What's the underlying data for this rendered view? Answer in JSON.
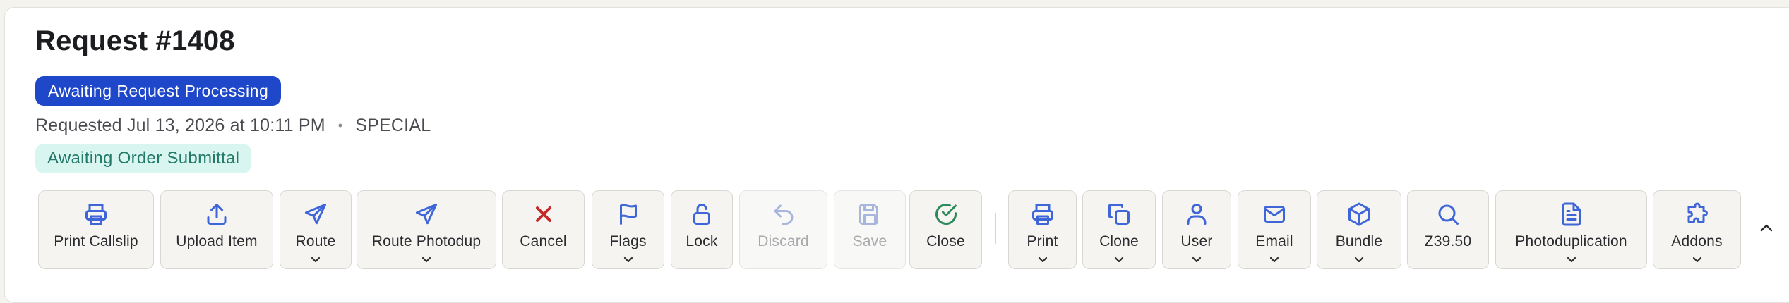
{
  "header": {
    "title": "Request #1408",
    "status_badge": "Awaiting Request Processing",
    "requested": "Requested Jul 13, 2026 at 10:11 PM",
    "separator": "•",
    "type": "SPECIAL",
    "order_badge": "Awaiting Order Submittal"
  },
  "colors": {
    "status_badge_bg": "#1f47c9",
    "order_badge_bg": "#d8f6ef",
    "icon_accent": "#3e66d8",
    "cancel_icon": "#c52a2a",
    "close_icon": "#2b8a5b"
  },
  "toolbar": {
    "primary": [
      {
        "label": "Print Callslip",
        "icon": "printer-icon",
        "dropdown": false,
        "disabled": false
      },
      {
        "label": "Upload Item",
        "icon": "upload-icon",
        "dropdown": false,
        "disabled": false
      },
      {
        "label": "Route",
        "icon": "send-icon",
        "dropdown": true,
        "disabled": false
      },
      {
        "label": "Route Photodup",
        "icon": "send-icon",
        "dropdown": true,
        "disabled": false
      },
      {
        "label": "Cancel",
        "icon": "x-icon",
        "dropdown": false,
        "disabled": false
      },
      {
        "label": "Flags",
        "icon": "flag-icon",
        "dropdown": true,
        "disabled": false
      },
      {
        "label": "Lock",
        "icon": "lock-icon",
        "dropdown": false,
        "disabled": false
      },
      {
        "label": "Discard",
        "icon": "undo-icon",
        "dropdown": false,
        "disabled": true
      },
      {
        "label": "Save",
        "icon": "save-icon",
        "dropdown": false,
        "disabled": true
      },
      {
        "label": "Close",
        "icon": "check-circle-icon",
        "dropdown": false,
        "disabled": false
      }
    ],
    "secondary": [
      {
        "label": "Print",
        "icon": "printer-icon",
        "dropdown": true,
        "disabled": false
      },
      {
        "label": "Clone",
        "icon": "copy-icon",
        "dropdown": true,
        "disabled": false
      },
      {
        "label": "User",
        "icon": "user-icon",
        "dropdown": true,
        "disabled": false
      },
      {
        "label": "Email",
        "icon": "mail-icon",
        "dropdown": true,
        "disabled": false
      },
      {
        "label": "Bundle",
        "icon": "box-icon",
        "dropdown": true,
        "disabled": false
      },
      {
        "label": "Z39.50",
        "icon": "search-icon",
        "dropdown": false,
        "disabled": false
      },
      {
        "label": "Photoduplication",
        "icon": "file-text-icon",
        "dropdown": true,
        "disabled": false
      },
      {
        "label": "Addons",
        "icon": "puzzle-icon",
        "dropdown": true,
        "disabled": false
      }
    ],
    "collapse_icon": "chevron-up-icon"
  }
}
